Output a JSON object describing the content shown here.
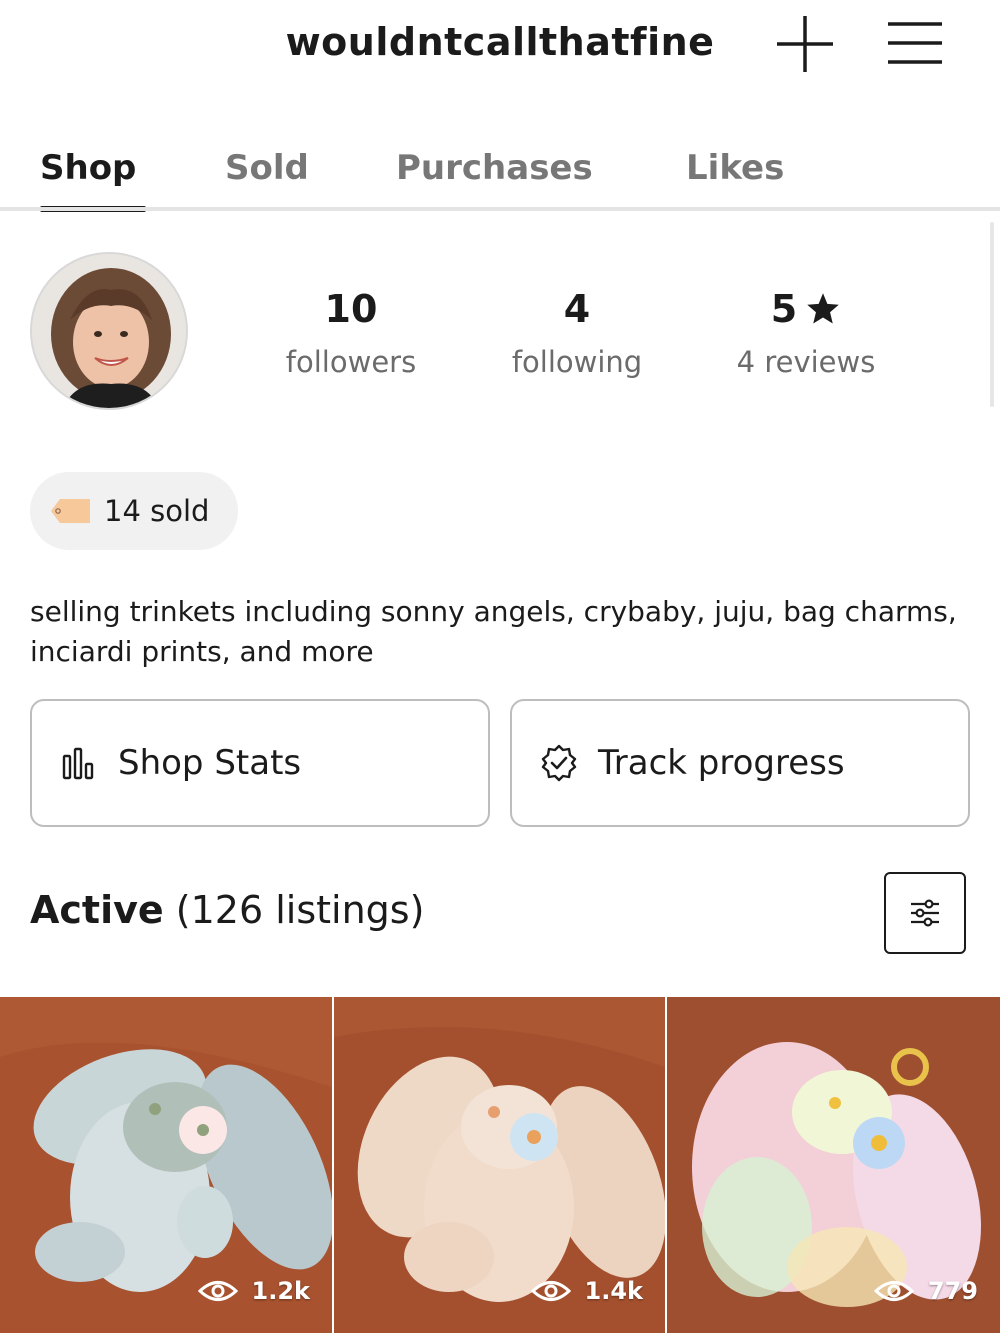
{
  "header": {
    "username": "wouldntcallthatfine",
    "icons": [
      "plus-icon",
      "menu-icon"
    ]
  },
  "tabs": [
    {
      "label": "Shop",
      "active": true
    },
    {
      "label": "Sold",
      "active": false
    },
    {
      "label": "Purchases",
      "active": false
    },
    {
      "label": "Likes",
      "active": false
    }
  ],
  "profile": {
    "stats": [
      {
        "value": "10",
        "label": "followers"
      },
      {
        "value": "4",
        "label": "following"
      },
      {
        "value": "5",
        "label": "4 reviews",
        "icon": "star-icon"
      }
    ],
    "sold_badge": "14 sold",
    "bio": "selling trinkets including sonny angels, crybaby, juju, bag charms, inciardi prints, and more"
  },
  "actions": {
    "shop_stats": "Shop Stats",
    "track_progress": "Track progress"
  },
  "active": {
    "title": "Active",
    "count_text": "(126 listings)"
  },
  "listings": [
    {
      "views": "1.2k",
      "plush_color": "#c9d6d8"
    },
    {
      "views": "1.4k",
      "plush_color": "#f1dccb"
    },
    {
      "views": "779",
      "plush_color": "#f3cfd8"
    }
  ],
  "colors": {
    "accent": "#1b1b1b",
    "muted_text": "#6b6b6b",
    "tag_orange": "#f6c89a",
    "photo_background": "#a8522f"
  }
}
